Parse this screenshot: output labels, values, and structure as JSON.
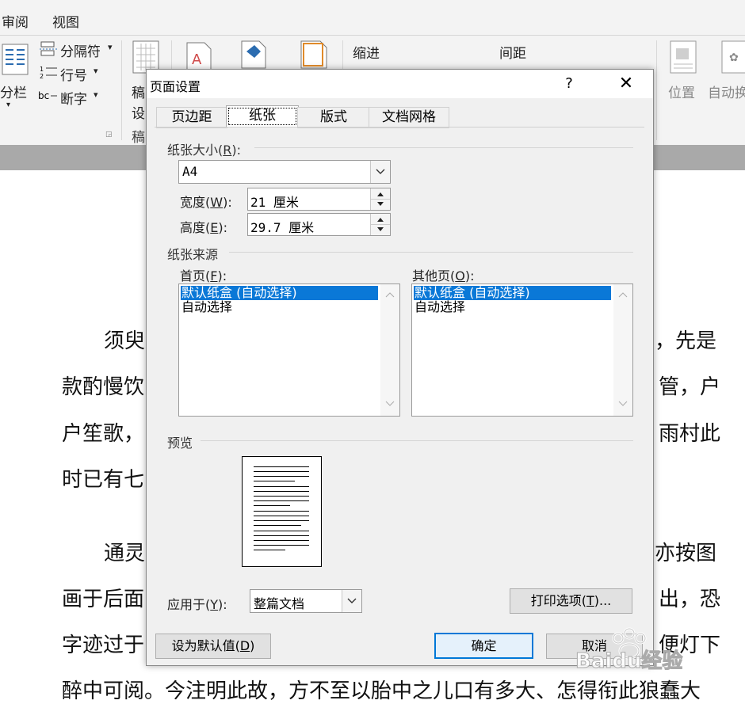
{
  "ribbon": {
    "tabs": [
      "审阅",
      "视图"
    ],
    "fenlan": "分栏",
    "fengefu": "分隔符",
    "hanghao": "行号",
    "duanzi": "断字",
    "gao": "稿",
    "she": "设",
    "gao2": "稿",
    "suojin": "缩进",
    "jianju": "间距",
    "weizhi": "位置",
    "zidonghuan": "自动换"
  },
  "document": {
    "lines": [
      {
        "left": "须臾",
        "right": "，先是"
      },
      {
        "left": "款酌慢饮",
        "right": "管，户"
      },
      {
        "left": "户笙歌，",
        "right": "雨村此"
      },
      {
        "left": "时已有七",
        "right": ""
      },
      {
        "left": "通灵",
        "right": "亦按图"
      },
      {
        "left": "画于后面",
        "right": "出，恐"
      },
      {
        "left": "字迹过于",
        "right": "便灯下"
      },
      {
        "left": "醉中可阅。今注明此故，方不至以胎中之儿口有多大、怎得衔此狼蠢大",
        "right": ""
      }
    ]
  },
  "dialog": {
    "title": "页面设置",
    "help": "?",
    "close": "✕",
    "tabs": [
      "页边距",
      "纸张",
      "版式",
      "文档网格"
    ],
    "active_tab": "纸张",
    "paper_size": {
      "group_label": "纸张大小(R):",
      "label_pre": "纸张大小(",
      "label_key": "R",
      "label_post": "):",
      "value": "A4",
      "width_label_pre": "宽度(",
      "width_key": "W",
      "width_label_post": "):",
      "width_value": "21 厘米",
      "height_label_pre": "高度(",
      "height_key": "E",
      "height_label_post": "):",
      "height_value": "29.7 厘米"
    },
    "paper_source": {
      "group_label": "纸张来源",
      "first_label_pre": "首页(",
      "first_key": "F",
      "first_label_post": "):",
      "other_label_pre": "其他页(",
      "other_key": "O",
      "other_label_post": "):",
      "first_items": [
        "默认纸盒 (自动选择)",
        "自动选择"
      ],
      "other_items": [
        "默认纸盒 (自动选择)",
        "自动选择"
      ]
    },
    "preview_label": "预览",
    "apply_to": {
      "label_pre": "应用于(",
      "label_key": "Y",
      "label_post": "):",
      "value": "整篇文档"
    },
    "print_options": {
      "pre": "打印选项(",
      "key": "T",
      "post": ")..."
    },
    "set_default": {
      "pre": "设为默认值(",
      "key": "D",
      "post": ")"
    },
    "ok": "确定",
    "cancel": "取消"
  },
  "watermark": "Baidu经验",
  "colors": {
    "selection": "#0a78d7",
    "default_button_border": "#0078d7",
    "dialog_bg": "#f0f0f0"
  }
}
